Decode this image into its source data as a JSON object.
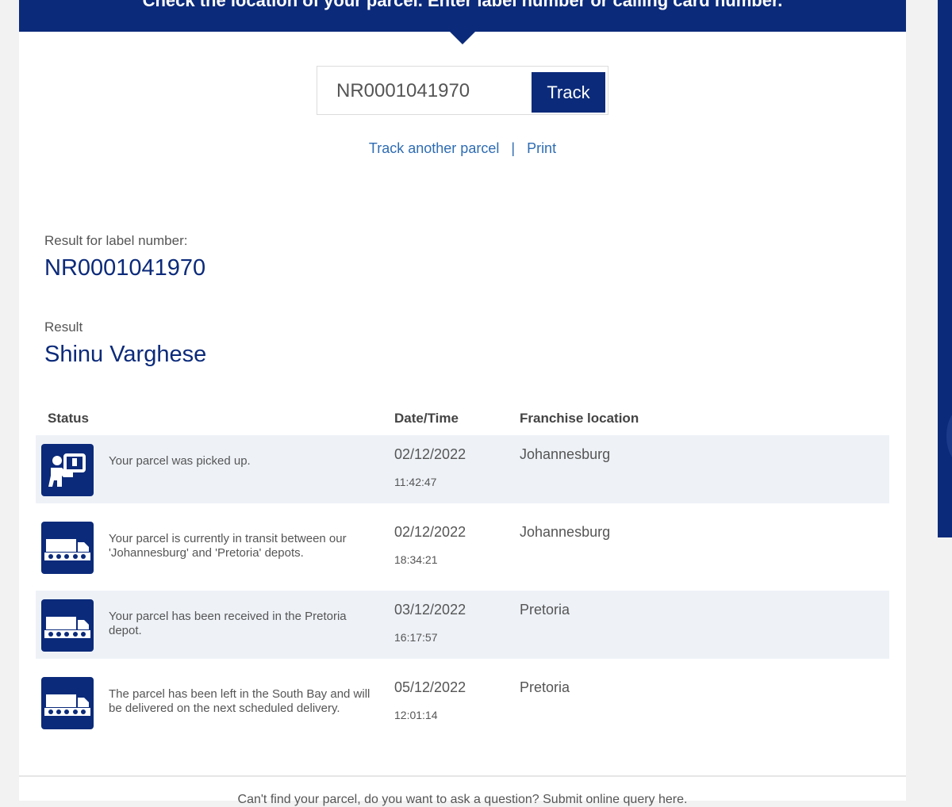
{
  "banner": {
    "text": "Check the location of your parcel. Enter label number or calling card number."
  },
  "search": {
    "value": "NR0001041970",
    "button_label": "Track"
  },
  "links": {
    "track_another": "Track another parcel",
    "separator": "|",
    "print": "Print"
  },
  "result_label": {
    "caption": "Result for label number:",
    "value": "NR0001041970"
  },
  "result_name": {
    "caption": "Result",
    "value": "Shinu Varghese"
  },
  "table": {
    "headers": {
      "status": "Status",
      "datetime": "Date/Time",
      "location": "Franchise location"
    },
    "rows": [
      {
        "icon": "parcel-pickup-icon",
        "status": "Your parcel was picked up.",
        "date": "02/12/2022",
        "time": "11:42:47",
        "location": "Johannesburg"
      },
      {
        "icon": "truck-icon",
        "status": "Your parcel is currently in transit between our 'Johannesburg' and 'Pretoria' depots.",
        "date": "02/12/2022",
        "time": "18:34:21",
        "location": "Johannesburg"
      },
      {
        "icon": "truck-icon",
        "status": "Your parcel has been received in the Pretoria depot.",
        "date": "03/12/2022",
        "time": "16:17:57",
        "location": "Pretoria"
      },
      {
        "icon": "truck-icon",
        "status": "The parcel has been left in the South Bay and will be delivered on the next scheduled delivery.",
        "date": "05/12/2022",
        "time": "12:01:14",
        "location": "Pretoria"
      }
    ]
  },
  "footer": {
    "text": "Can't find your parcel, do you want to ask a question? Submit online query here."
  },
  "colors": {
    "brand": "#0b2a7a",
    "link": "#2e6cb3",
    "row_shade": "#eef2f7"
  }
}
